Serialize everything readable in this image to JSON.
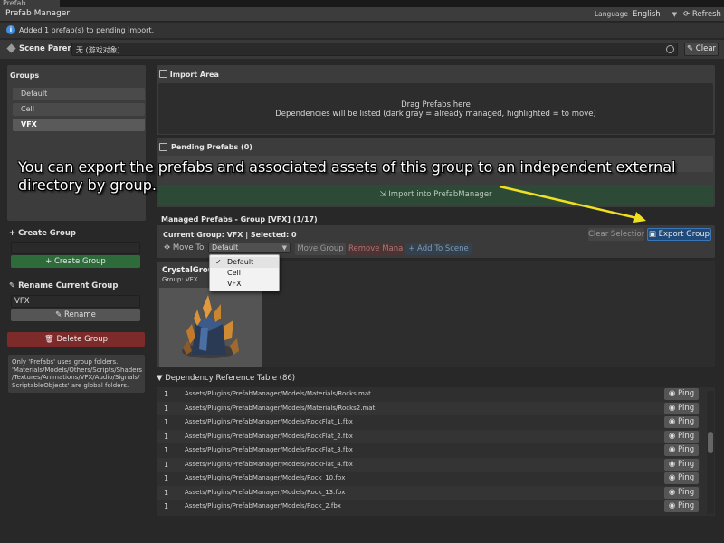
{
  "window_tab": "Prefab Manager",
  "title": "Prefab Manager",
  "language": {
    "label": "Language",
    "value": "English"
  },
  "refresh_label": "Refresh",
  "notice": "Added 1 prefab(s) to pending import.",
  "scene_parent": {
    "label": "Scene Parent",
    "value": "无 (游戏对象)",
    "clear_label": "Clear"
  },
  "groups": {
    "title": "Groups",
    "items": [
      {
        "label": "Default",
        "selected": false
      },
      {
        "label": "Cell",
        "selected": false
      },
      {
        "label": "VFX",
        "selected": true
      }
    ]
  },
  "create_group": {
    "title": "Create Group",
    "button": "Create Group",
    "value": ""
  },
  "rename_group": {
    "title": "Rename Current Group",
    "value": "VFX",
    "button": "Rename"
  },
  "delete_label": "Delete Group",
  "note": "Only 'Prefabs' uses group folders. 'Materials/Models/Others/Scripts/Shaders /Textures/Animations/VFX/Audio/Signals/ ScriptableObjects' are global folders.",
  "import_area": {
    "title": "Import Area",
    "line1": "Drag Prefabs here",
    "line2": "Dependencies will be listed (dark gray = already managed, highlighted = to move)"
  },
  "pending": {
    "title": "Pending Prefabs (0)",
    "import_button": "Import into PrefabManager"
  },
  "managed": {
    "title": "Managed Prefabs - Group [VFX] (1/17)",
    "current": "Current Group: VFX | Selected: 0",
    "clear_selection": "Clear Selection",
    "export": "Export Group",
    "move_to_label": "Move To",
    "move_to_value": "Default",
    "move_group": "Move Group",
    "remove": "Remove Manag",
    "add_to_scene": "Add To Scene",
    "dropdown_options": [
      "Default",
      "Cell",
      "VFX"
    ],
    "dropdown_checked": "Default"
  },
  "card": {
    "title": "CrystalGroup",
    "subtitle": "Group: VFX"
  },
  "dependency": {
    "title": "Dependency Reference Table (86)",
    "ping_label": "Ping",
    "rows": [
      {
        "count": "1",
        "path": "Assets/Plugins/PrefabManager/Models/Materials/Rocks.mat"
      },
      {
        "count": "1",
        "path": "Assets/Plugins/PrefabManager/Models/Materials/Rocks2.mat"
      },
      {
        "count": "1",
        "path": "Assets/Plugins/PrefabManager/Models/RockFlat_1.fbx"
      },
      {
        "count": "1",
        "path": "Assets/Plugins/PrefabManager/Models/RockFlat_2.fbx"
      },
      {
        "count": "1",
        "path": "Assets/Plugins/PrefabManager/Models/RockFlat_3.fbx"
      },
      {
        "count": "1",
        "path": "Assets/Plugins/PrefabManager/Models/RockFlat_4.fbx"
      },
      {
        "count": "1",
        "path": "Assets/Plugins/PrefabManager/Models/Rock_10.fbx"
      },
      {
        "count": "1",
        "path": "Assets/Plugins/PrefabManager/Models/Rock_13.fbx"
      },
      {
        "count": "1",
        "path": "Assets/Plugins/PrefabManager/Models/Rock_2.fbx"
      }
    ]
  },
  "annotation": "You can export the prefabs and associated assets of this group to an independent external directory by group.",
  "icons": {
    "info": "info-icon",
    "scene": "cube-icon",
    "target": "target-icon",
    "refresh": "refresh-icon",
    "plus": "plus-icon",
    "pencil": "pencil-icon",
    "trash": "trash-icon",
    "import": "import-icon",
    "export": "export-icon",
    "move": "move-icon",
    "eye": "eye-icon"
  },
  "colors": {
    "create": "#2d6b3a",
    "delete": "#7c2a2a",
    "export": "#1f4a7a",
    "annotation_arrow": "#f0e020"
  }
}
